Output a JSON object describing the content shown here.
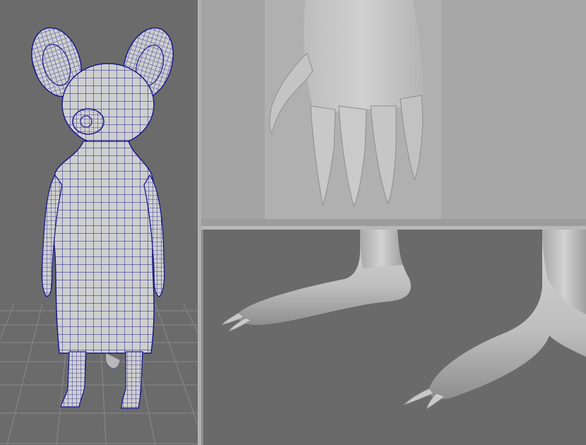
{
  "viewports": {
    "perspective": {
      "name": "perspective-wireframe-view",
      "background": "#6b6b6b",
      "grid_color": "#8a8a8a"
    },
    "hand": {
      "name": "hand-closeup-view",
      "background": "#a9a9a9"
    },
    "feet": {
      "name": "feet-closeup-view",
      "background": "#6a6a6a"
    }
  },
  "colors": {
    "wireframe": "#1a1a8c",
    "mesh_fill": "#c9c9c9",
    "shaded_light": "#d6d6d6",
    "shaded_dark": "#8e8e8e"
  }
}
